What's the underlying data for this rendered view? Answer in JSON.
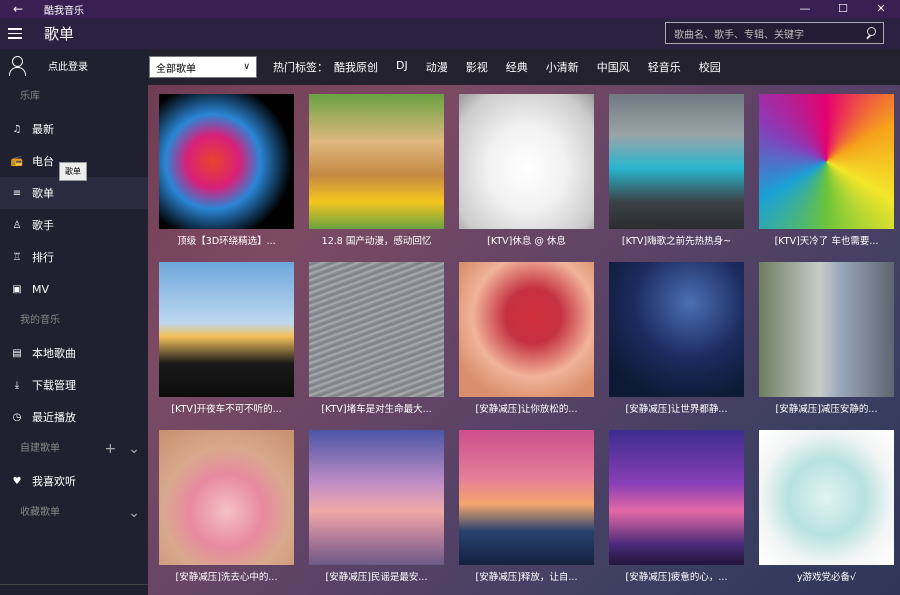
{
  "window": {
    "app_title": "酷我音乐",
    "back_glyph": "←",
    "controls": [
      "—",
      "☐",
      "✕"
    ]
  },
  "header": {
    "page_title": "歌单",
    "search_placeholder": "歌曲名、歌手、专辑、关键字"
  },
  "sidebar": {
    "login_label": "点此登录",
    "section_library": "乐库",
    "library_items": [
      {
        "label": "最新",
        "icon": "music-note-icon"
      },
      {
        "label": "电台",
        "icon": "radio-icon"
      },
      {
        "label": "歌单",
        "icon": "playlist-icon"
      },
      {
        "label": "歌手",
        "icon": "singer-icon"
      },
      {
        "label": "排行",
        "icon": "trophy-icon"
      },
      {
        "label": "MV",
        "icon": "mv-icon"
      }
    ],
    "section_mine": "我的音乐",
    "mine_items": [
      {
        "label": "本地歌曲",
        "icon": "local-music-icon"
      },
      {
        "label": "下载管理",
        "icon": "download-icon"
      },
      {
        "label": "最近播放",
        "icon": "recent-icon"
      }
    ],
    "section_created": "自建歌单",
    "favorite_label": "我喜欢听",
    "section_collected": "收藏歌单",
    "tooltip": "歌单"
  },
  "filter": {
    "selected": "全部歌单",
    "hot_label": "热门标签：",
    "tags": [
      "酷我原创",
      "DJ",
      "动漫",
      "影视",
      "经典",
      "小清新",
      "中国风",
      "轻音乐",
      "校园"
    ]
  },
  "playlists": [
    {
      "caption": "顶级【3D环绕精选】..."
    },
    {
      "caption": "12.8 国产动漫，感动回忆"
    },
    {
      "caption": "[KTV]休息 @ 休息"
    },
    {
      "caption": "[KTV]嗨歌之前先热热身~"
    },
    {
      "caption": "[KTV]天冷了 车也需要..."
    },
    {
      "caption": "[KTV]开夜车不可不听的..."
    },
    {
      "caption": "[KTV]堵车是对生命最大..."
    },
    {
      "caption": "[安静减压]让你放松的..."
    },
    {
      "caption": "[安静减压]让世界都静..."
    },
    {
      "caption": "[安静减压]减压安静的..."
    },
    {
      "caption": "[安静减压]洗去心中的..."
    },
    {
      "caption": "[安静减压]民谣是最安..."
    },
    {
      "caption": "[安静减压]释放，让自..."
    },
    {
      "caption": "[安静减压]疲惫的心，..."
    },
    {
      "caption": "y游戏党必备√"
    }
  ]
}
